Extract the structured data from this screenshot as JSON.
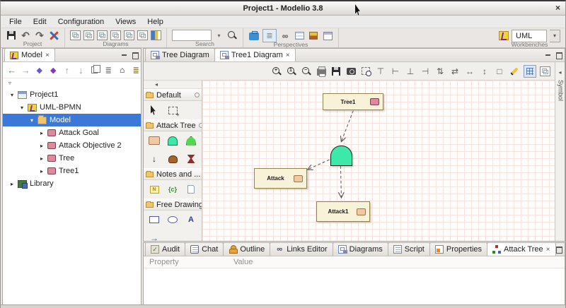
{
  "window": {
    "title": "Project1 - Modelio 3.8",
    "close": "×"
  },
  "menu": {
    "items": [
      "File",
      "Edit",
      "Configuration",
      "Views",
      "Help"
    ]
  },
  "toolbar": {
    "project_label": "Project",
    "diagrams_label": "Diagrams",
    "search_label": "Search",
    "search_value": "",
    "perspectives_label": "Perspectives",
    "workbenches_label": "Workbenches",
    "workbench_selected": "UML"
  },
  "icons": {
    "undo": "↶",
    "redo": "↷",
    "back": "←",
    "forward": "→",
    "up": "↑",
    "down": "↓",
    "diamond": "◆",
    "home": "⌂",
    "list": "≣",
    "dropdown": "▾",
    "small_chevron": "▿",
    "collapse_left": "◂",
    "chain": "∞",
    "close": "×",
    "down_tool": "↓",
    "flow_arrow": "→"
  },
  "model_panel": {
    "title": "Model",
    "close": "×"
  },
  "tree": {
    "items": [
      {
        "label": "Project1",
        "depth": 0,
        "arrow": "▾"
      },
      {
        "label": "UML-BPMN",
        "depth": 1,
        "arrow": "▾"
      },
      {
        "label": "Model",
        "depth": 2,
        "arrow": "▾",
        "selected": true
      },
      {
        "label": "Attack Goal",
        "depth": 3,
        "arrow": "▸"
      },
      {
        "label": "Attack Objective 2",
        "depth": 3,
        "arrow": "▸"
      },
      {
        "label": "Tree",
        "depth": 3,
        "arrow": "▸"
      },
      {
        "label": "Tree1",
        "depth": 3,
        "arrow": "▸"
      },
      {
        "label": "Library",
        "depth": 0,
        "arrow": "▸"
      }
    ]
  },
  "editor": {
    "tabs": [
      {
        "label": "Tree Diagram",
        "active": false
      },
      {
        "label": "Tree1 Diagram",
        "active": true,
        "close": "×"
      }
    ]
  },
  "palette": {
    "groups": [
      {
        "label": "Default"
      },
      {
        "label": "Attack Tree"
      },
      {
        "label": "Notes and ..."
      },
      {
        "label": "Free Drawing"
      }
    ],
    "note_letter": "N",
    "constraint_glyph": "{c}",
    "text_tool": "A"
  },
  "canvas": {
    "nodes": {
      "tree1": "Tree1",
      "attack": "Attack",
      "attack1": "Attack1"
    },
    "colors": {
      "node_fill": "#f8f2d8",
      "node_border": "#8f854d",
      "gate_fill": "#3ce9a8",
      "pink_icon": "#e0889d",
      "tan_icon": "#f0c9a2",
      "selection_blue": "#3c78d8"
    }
  },
  "symbol_panel": {
    "label": "Symbol"
  },
  "bottom_panel": {
    "tabs": [
      {
        "label": "Audit"
      },
      {
        "label": "Chat"
      },
      {
        "label": "Outline"
      },
      {
        "label": "Links Editor"
      },
      {
        "label": "Diagrams"
      },
      {
        "label": "Script"
      },
      {
        "label": "Properties"
      },
      {
        "label": "Attack Tree",
        "active": true,
        "close": "×"
      }
    ],
    "columns": [
      "Property",
      "Value"
    ]
  }
}
